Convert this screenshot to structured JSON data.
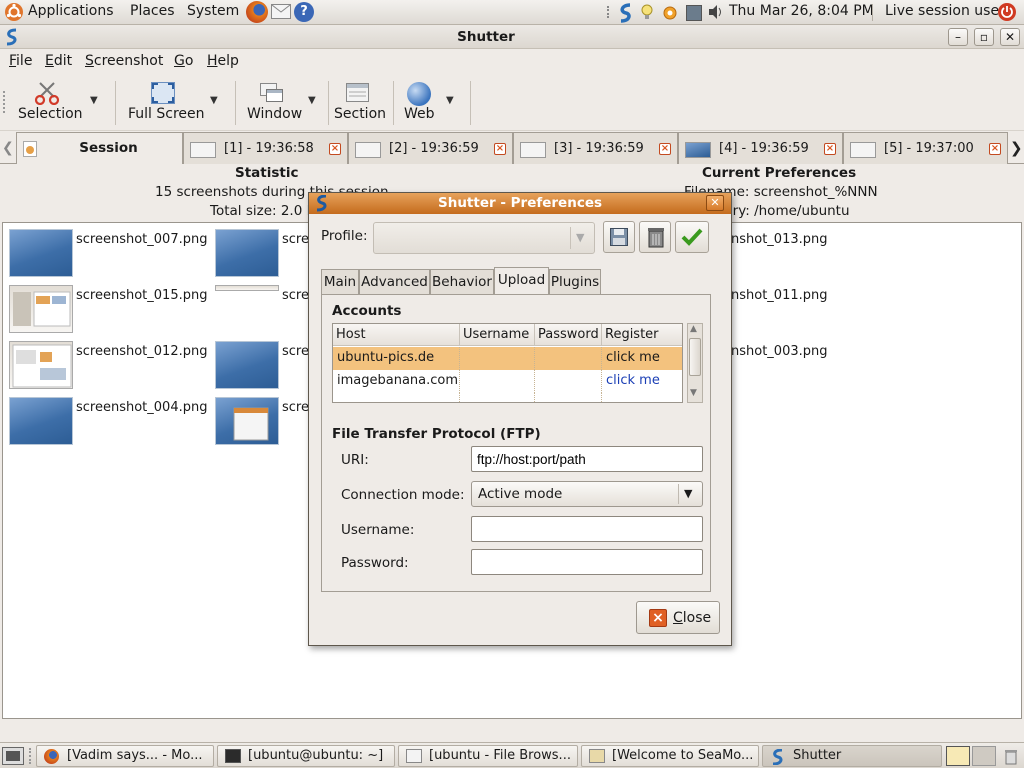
{
  "top_panel": {
    "menus": [
      "Applications",
      "Places",
      "System"
    ],
    "clock": "Thu Mar 26,  8:04 PM",
    "user": "Live session user"
  },
  "window": {
    "title": "Shutter",
    "controls": [
      "minimize-icon",
      "maximize-icon",
      "close-icon"
    ]
  },
  "menubar": {
    "items": [
      {
        "label": "File",
        "accel": "F",
        "rest": "ile"
      },
      {
        "label": "Edit",
        "accel": "E",
        "rest": "dit"
      },
      {
        "label": "Screenshot",
        "accel": "S",
        "rest": "creenshot"
      },
      {
        "label": "Go",
        "accel": "G",
        "rest": "o"
      },
      {
        "label": "Help",
        "accel": "H",
        "rest": "elp"
      }
    ]
  },
  "toolbar": {
    "selection": "Selection",
    "full_screen": "Full Screen",
    "window": "Window",
    "section": "Section",
    "web": "Web"
  },
  "tabs": {
    "session": "Session",
    "items": [
      "[1] - 19:36:58",
      "[2] - 19:36:59",
      "[3] - 19:36:59",
      "[4] - 19:36:59",
      "[5] - 19:37:00"
    ]
  },
  "statistic": {
    "heading": "Statistic",
    "line1": "15 screenshots during this session",
    "line2": "Total size: 2.0 MB"
  },
  "current_prefs": {
    "heading": "Current Preferences",
    "line1": "Filename: screenshot_%NNN",
    "line2": "Directory: /home/ubuntu"
  },
  "files": {
    "col1": [
      "screenshot_007.png",
      "screenshot_015.png",
      "screenshot_012.png",
      "screenshot_004.png"
    ],
    "col2": [
      "scre",
      "scre",
      "scre",
      "scre"
    ],
    "col3": [
      "nshot_013.png",
      "nshot_011.png",
      "nshot_003.png"
    ]
  },
  "taskbar": {
    "items": [
      "[Vadim says... - Mo...",
      "[ubuntu@ubuntu: ~]",
      "[ubuntu - File Brows...",
      "[Welcome to SeaMo...",
      "Shutter"
    ]
  },
  "dialog": {
    "title": "Shutter - Preferences",
    "profile_label": "Profile:",
    "tabs": [
      "Main",
      "Advanced",
      "Behavior",
      "Upload",
      "Plugins"
    ],
    "accounts_title": "Accounts",
    "accounts_columns": [
      "Host",
      "Username",
      "Password",
      "Register"
    ],
    "accounts_rows": [
      {
        "host": "ubuntu-pics.de",
        "username": "",
        "password": "",
        "register": "click me"
      },
      {
        "host": "imagebanana.com",
        "username": "",
        "password": "",
        "register": "click me"
      }
    ],
    "ftp_title": "File Transfer Protocol (FTP)",
    "uri_label": "URI:",
    "uri_value": "ftp://host:port/path",
    "mode_label": "Connection mode:",
    "mode_value": "Active mode",
    "username_label": "Username:",
    "password_label": "Password:",
    "close_accel": "C",
    "close_rest": "lose"
  },
  "colors": {
    "dialog_title": "#d27f32",
    "selection_row": "#f3c27e",
    "close_x": "#d9541e"
  }
}
